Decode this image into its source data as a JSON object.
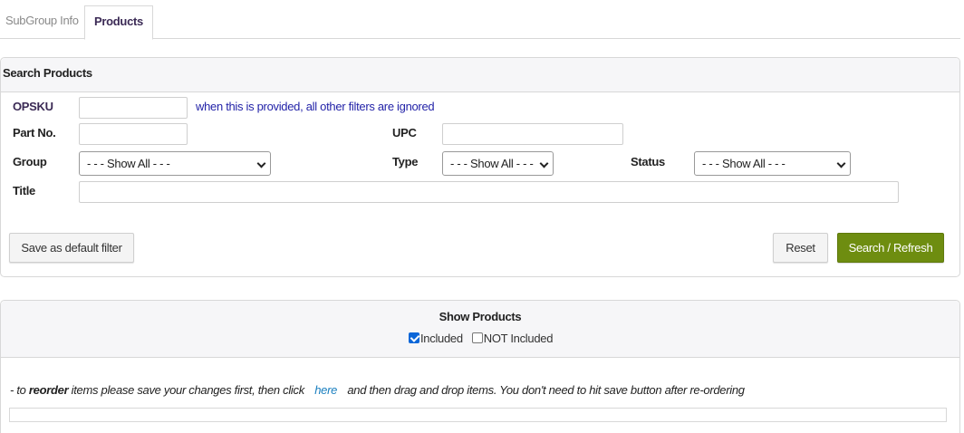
{
  "tabs": [
    {
      "label": "SubGroup Info",
      "active": false
    },
    {
      "label": "Products",
      "active": true
    }
  ],
  "search": {
    "title": "Search Products",
    "opsku": {
      "label": "OPSKU",
      "value": "",
      "hint": "when this is provided, all other filters are ignored"
    },
    "part_no": {
      "label": "Part No.",
      "value": ""
    },
    "upc": {
      "label": "UPC",
      "value": ""
    },
    "group": {
      "label": "Group",
      "selected": "- - - Show All - - -"
    },
    "type": {
      "label": "Type",
      "selected": "- - - Show All - - -"
    },
    "status": {
      "label": "Status",
      "selected": "- - - Show All - - -"
    },
    "title_field": {
      "label": "Title",
      "value": ""
    },
    "save_default_label": "Save as default filter",
    "reset_label": "Reset",
    "search_refresh_label": "Search / Refresh"
  },
  "show_products": {
    "title": "Show Products",
    "options": [
      {
        "label": "Included",
        "checked": true
      },
      {
        "label": "NOT Included",
        "checked": false
      }
    ]
  },
  "reorder": {
    "prefix": "- to ",
    "bold": "reorder",
    "middle": " items please save your changes first, then click ",
    "link": "here",
    "suffix": " and then drag and drop items. You don't need to hit save button after re-ordering"
  },
  "colors": {
    "accent_green": "#6e8d10",
    "link_blue": "#1a7fbf",
    "hint_blue": "#2323a8",
    "tab_active": "#3b2a55"
  }
}
